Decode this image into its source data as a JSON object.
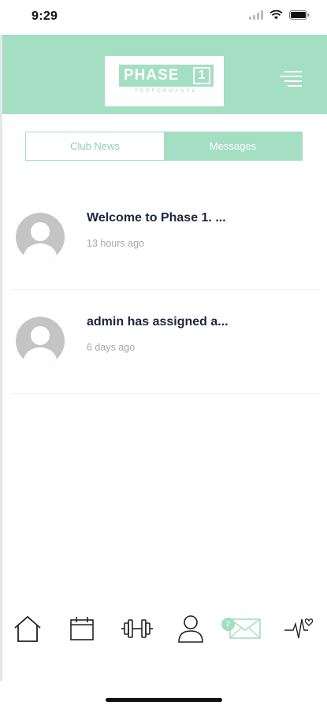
{
  "status_bar": {
    "time": "9:29"
  },
  "header": {
    "logo_word": "PHASE",
    "logo_number": "1",
    "logo_subtitle": "PERFORMANCE"
  },
  "tabs": [
    {
      "label": "Club News",
      "active": false
    },
    {
      "label": "Messages",
      "active": true
    }
  ],
  "messages": [
    {
      "title": "Welcome to Phase 1. ...",
      "time": "13 hours ago"
    },
    {
      "title": "admin has assigned a...",
      "time": "6 days ago"
    }
  ],
  "bottom_nav": {
    "items": [
      "home-icon",
      "calendar-icon",
      "dumbbell-icon",
      "profile-icon",
      "envelope-icon",
      "heartbeat-icon"
    ],
    "messages_badge": "2"
  },
  "colors": {
    "accent": "#a4dec3",
    "title_text": "#1e2540",
    "muted_text": "#a8a8a8"
  }
}
